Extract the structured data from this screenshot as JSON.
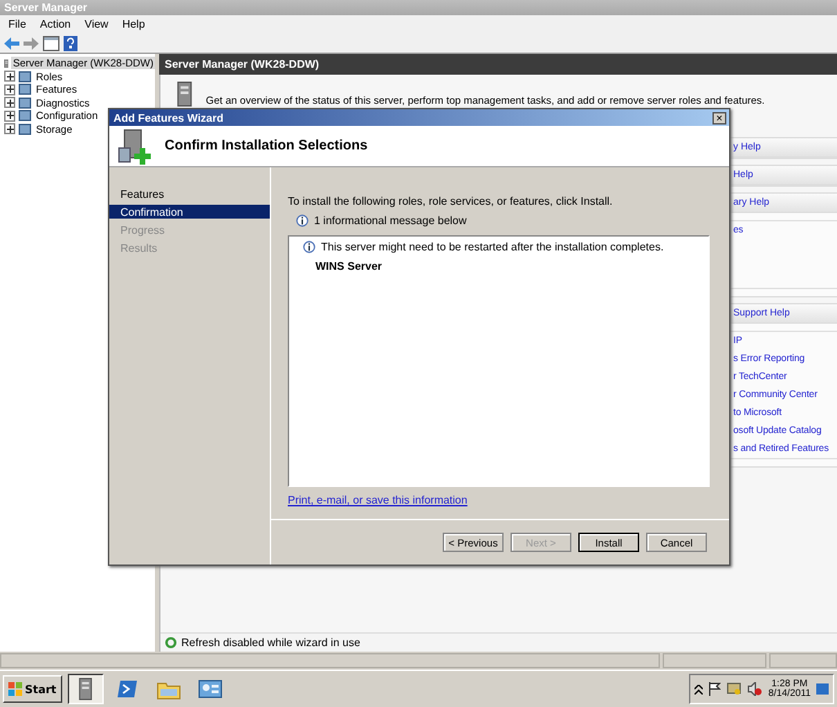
{
  "window": {
    "title": "Server Manager"
  },
  "menu": [
    "File",
    "Action",
    "View",
    "Help"
  ],
  "tree": [
    {
      "label": "Server Manager (WK28-DDW)",
      "selected": true,
      "children": [
        {
          "label": "Roles",
          "expanded": false
        },
        {
          "label": "Features",
          "expanded": false
        },
        {
          "label": "Diagnostics",
          "expanded": false
        },
        {
          "label": "Configuration",
          "expanded": false
        },
        {
          "label": "Storage",
          "expanded": false
        }
      ]
    }
  ],
  "pane": {
    "header": "Server Manager (WK28-DDW)",
    "overview": "Get an overview of the status of this server, perform top management tasks, and add or remove server roles and features.",
    "help_panels": [
      {
        "title": "y Help"
      },
      {
        "title": "Help"
      },
      {
        "title": "ary Help",
        "links": [
          "es"
        ]
      },
      {
        "title": "Support Help",
        "links": [
          "IP",
          "s Error Reporting",
          "r TechCenter",
          "r Community Center",
          "to Microsoft",
          "osoft Update Catalog",
          "s and Retired Features"
        ]
      }
    ],
    "status": "Refresh disabled while wizard in use"
  },
  "dialog": {
    "title": "Add Features Wizard",
    "close": "×",
    "heading": "Confirm Installation Selections",
    "steps": [
      {
        "label": "Features",
        "selected": false,
        "disabled": false
      },
      {
        "label": "Confirmation",
        "selected": true,
        "disabled": false
      },
      {
        "label": "Progress",
        "selected": false,
        "disabled": true
      },
      {
        "label": "Results",
        "selected": false,
        "disabled": true
      }
    ],
    "instruction": "To install the following roles, role services, or features, click Install.",
    "message_count": "1 informational message below",
    "notice": "This server might need to be restarted after the installation completes.",
    "items": [
      "WINS Server"
    ],
    "link": "Print, e-mail, or save this information",
    "buttons": [
      {
        "label": "< Previous",
        "disabled": false,
        "default": false
      },
      {
        "label": "Next >",
        "disabled": true,
        "default": false
      },
      {
        "label": "Install",
        "disabled": false,
        "default": true
      },
      {
        "label": "Cancel",
        "disabled": false,
        "default": false
      }
    ]
  },
  "taskbar": {
    "start": "Start",
    "apps": [
      {
        "kind": "server",
        "selected": true
      },
      {
        "kind": "powershell",
        "selected": false
      },
      {
        "kind": "explorer",
        "selected": false
      },
      {
        "kind": "control",
        "selected": false
      }
    ],
    "time": "1:28 PM",
    "date": "8/14/2011"
  }
}
